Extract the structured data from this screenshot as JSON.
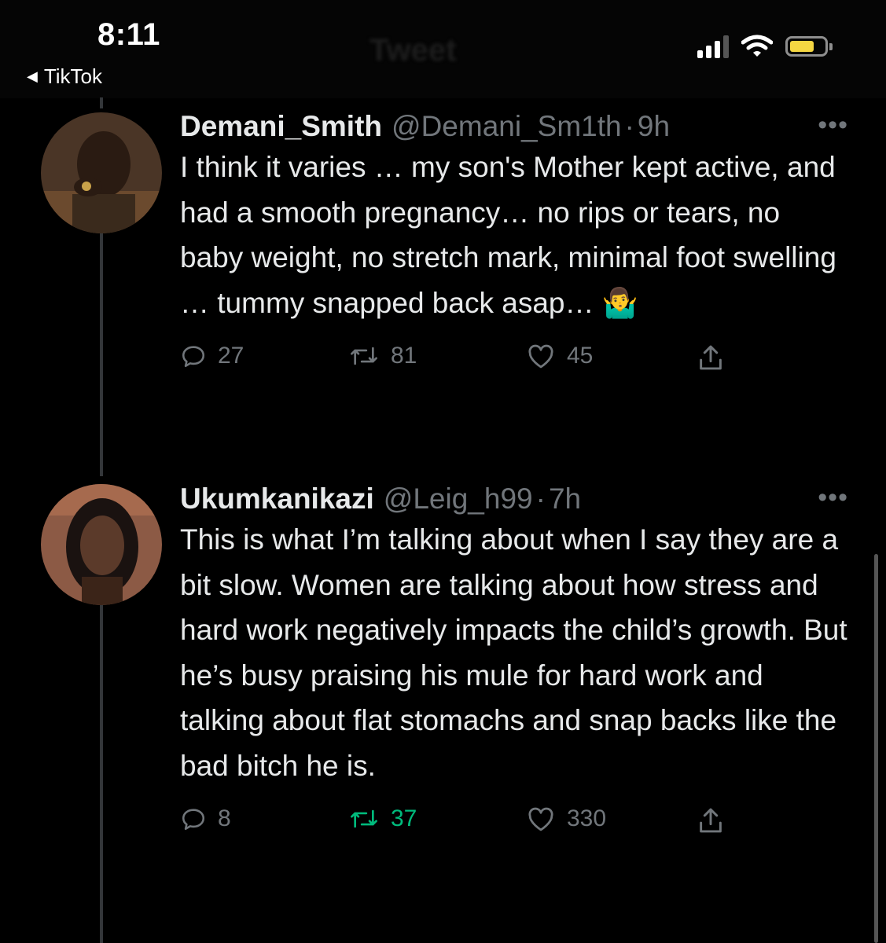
{
  "status_bar": {
    "time": "8:11",
    "back_app": "TikTok",
    "header_title": "Tweet",
    "battery_color": "#f5d742"
  },
  "tweets": [
    {
      "display_name": "Demani_Smith",
      "handle": "@Demani_Sm1th",
      "separator": "·",
      "time_ago": "9h",
      "text": "I think it varies … my son's Mother kept active, and had a smooth pregnancy… no rips or tears, no baby weight, no stretch mark, minimal foot swelling … tummy snapped back asap… 🤷‍♂️",
      "replies": "27",
      "retweets": "81",
      "likes": "45",
      "retweeted": false
    },
    {
      "display_name": "Ukumkanikazi",
      "handle": "@Leig_h99",
      "separator": "·",
      "time_ago": "7h",
      "text": "This is what I’m talking about when I say they are a bit slow. Women are talking about how stress and hard work negatively impacts the child’s growth. But he’s busy praising his mule for hard work and talking about flat stomachs and snap backs like the bad bitch he is.",
      "replies": "8",
      "retweets": "37",
      "likes": "330",
      "retweeted": true
    }
  ],
  "icons": {
    "reply": "reply-icon",
    "retweet": "retweet-icon",
    "like": "heart-icon",
    "share": "share-icon",
    "more": "more-icon"
  },
  "colors": {
    "background": "#000000",
    "text": "#e7e9ea",
    "muted": "#71767b",
    "retweet_active": "#00ba7c"
  }
}
